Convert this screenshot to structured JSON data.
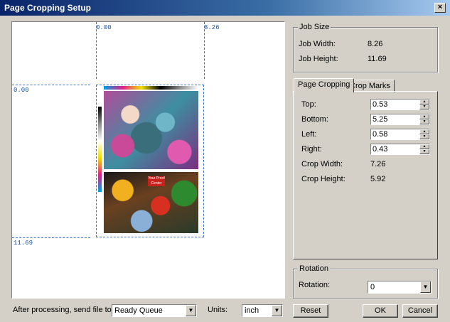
{
  "window": {
    "title": "Page Cropping Setup",
    "close_glyph": "×"
  },
  "preview": {
    "ruler_top_left": "0.00",
    "ruler_top_right": "8.26",
    "ruler_left_top": "0.00",
    "ruler_left_bottom": "11.69",
    "stamp_text": "Your Proof Center"
  },
  "job_size": {
    "title": "Job Size",
    "width_label": "Job Width:",
    "width_value": "8.26",
    "height_label": "Job Height:",
    "height_value": "11.69"
  },
  "tabs": {
    "cropping": "Page Cropping",
    "marks": "Crop Marks"
  },
  "cropping": {
    "top_label": "Top:",
    "top_value": "0.53",
    "bottom_label": "Bottom:",
    "bottom_value": "5.25",
    "left_label": "Left:",
    "left_value": "0.58",
    "right_label": "Right:",
    "right_value": "0.43",
    "crop_width_label": "Crop Width:",
    "crop_width_value": "7.26",
    "crop_height_label": "Crop Height:",
    "crop_height_value": "5.92"
  },
  "rotation": {
    "title": "Rotation",
    "label": "Rotation:",
    "value": "0"
  },
  "footer": {
    "after_label": "After processing, send file to:",
    "queue_value": "Ready Queue",
    "units_label": "Units:",
    "units_value": "inch",
    "reset": "Reset",
    "ok": "OK",
    "cancel": "Cancel"
  }
}
